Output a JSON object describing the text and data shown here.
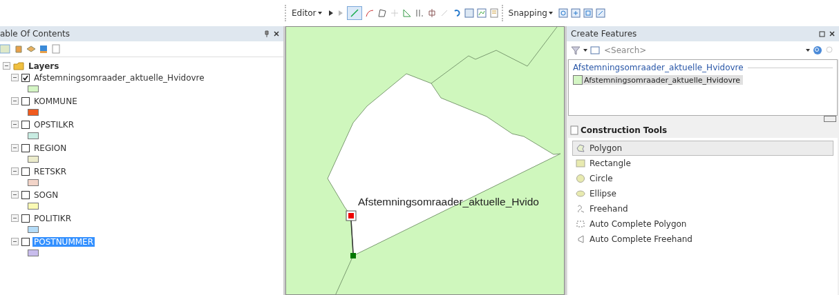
{
  "toolbar": {
    "editor_label": "Editor",
    "snapping_label": "Snapping"
  },
  "table_of_contents": {
    "title": "able Of Contents",
    "root": {
      "label": "Layers",
      "expanded": true,
      "children": [
        {
          "label": "Afstemningsomraader_aktuelle_Hvidovre",
          "checked": true,
          "selected": false,
          "color": "#d4f5c4"
        },
        {
          "label": "KOMMUNE",
          "checked": false,
          "selected": false,
          "color": "#f05a1e"
        },
        {
          "label": "OPSTILKR",
          "checked": false,
          "selected": false,
          "color": "#c8ece2"
        },
        {
          "label": "REGION",
          "checked": false,
          "selected": false,
          "color": "#ececcc"
        },
        {
          "label": "RETSKR",
          "checked": false,
          "selected": false,
          "color": "#f2d4c8"
        },
        {
          "label": "SOGN",
          "checked": false,
          "selected": false,
          "color": "#fafab4"
        },
        {
          "label": "POLITIKR",
          "checked": false,
          "selected": false,
          "color": "#b4dcf8"
        },
        {
          "label": "POSTNUMMER",
          "checked": false,
          "selected": true,
          "color": "#c8bcec"
        }
      ]
    }
  },
  "map": {
    "label": "Afstemningsomraader_aktuelle_Hvido"
  },
  "create_features": {
    "title": "Create Features",
    "search": {
      "placeholder": "<Search>"
    },
    "group": "Afstemningsomraader_aktuelle_Hvidovre",
    "templates": [
      {
        "label": "Afstemningsomraader_aktuelle_Hvidovre",
        "selected": true,
        "color": "#d4f5c4"
      }
    ]
  },
  "construction_tools": {
    "title": "Construction Tools",
    "tools": [
      {
        "label": "Polygon",
        "kind": "polygon",
        "selected": true
      },
      {
        "label": "Rectangle",
        "kind": "rectangle",
        "selected": false
      },
      {
        "label": "Circle",
        "kind": "circle",
        "selected": false
      },
      {
        "label": "Ellipse",
        "kind": "ellipse",
        "selected": false
      },
      {
        "label": "Freehand",
        "kind": "freehand",
        "selected": false
      },
      {
        "label": "Auto Complete Polygon",
        "kind": "autopolygon",
        "selected": false
      },
      {
        "label": "Auto Complete Freehand",
        "kind": "autofreehand",
        "selected": false
      }
    ]
  }
}
